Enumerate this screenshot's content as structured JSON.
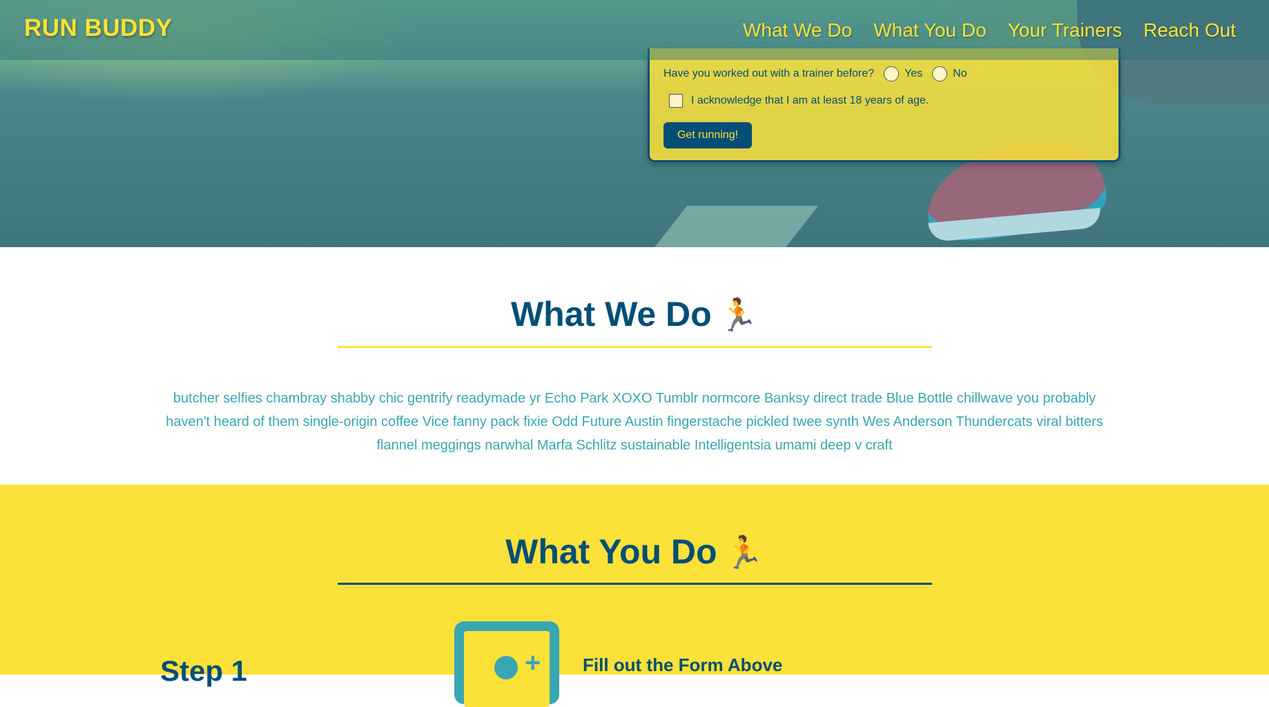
{
  "header": {
    "logo": "RUN BUDDY",
    "nav": [
      "What We Do",
      "What You Do",
      "Your Trainers",
      "Reach Out"
    ]
  },
  "form": {
    "trainer_question": "Have you worked out with a trainer before?",
    "option_yes": "Yes",
    "option_no": "No",
    "age_ack": "I acknowledge that I am at least 18 years of age.",
    "submit_label": "Get running!"
  },
  "what_we_do": {
    "title": "What We Do",
    "icon": "🏃",
    "body": "butcher selfies chambray shabby chic gentrify readymade yr Echo Park XOXO Tumblr normcore Banksy direct trade Blue Bottle chillwave you probably haven't heard of them single-origin coffee Vice fanny pack fixie Odd Future Austin fingerstache pickled twee synth Wes Anderson Thundercats viral bitters flannel meggings narwhal Marfa Schlitz sustainable Intelligentsia umami deep v craft"
  },
  "what_you_do": {
    "title": "What You Do",
    "icon": "🏃",
    "step_label": "Step 1",
    "step_heading": "Fill out the Form Above"
  },
  "colors": {
    "primary": "#024e76",
    "accent": "#fce138",
    "secondary": "#39a6b2"
  }
}
